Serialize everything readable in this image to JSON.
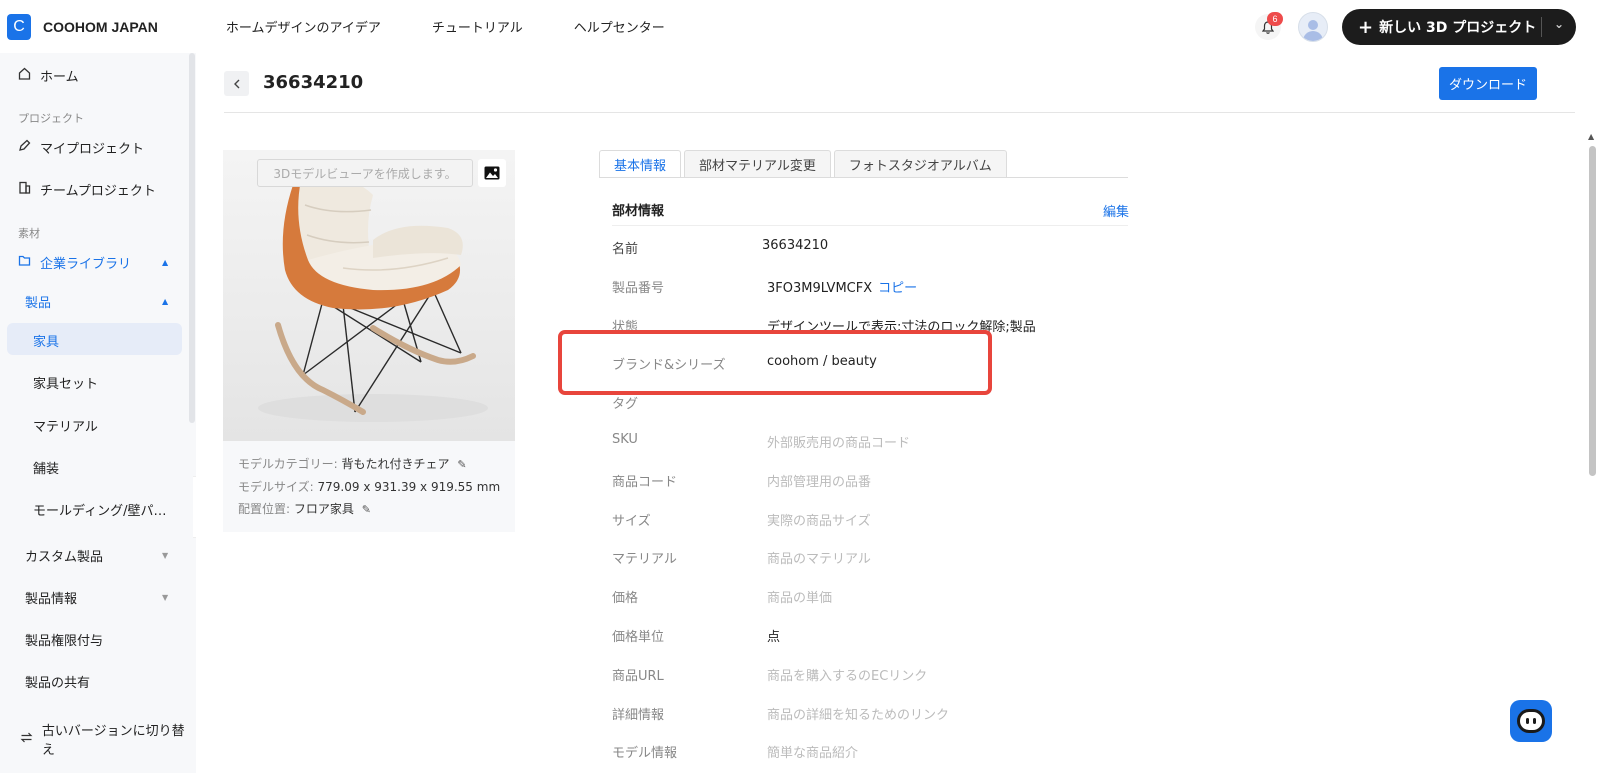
{
  "brand": {
    "logo_letter": "C",
    "name": "COOHOM JAPAN"
  },
  "topnav": {
    "items": [
      "ホームデザインのアイデア",
      "チュートリアル",
      "ヘルプセンター"
    ]
  },
  "top_right": {
    "notification_count": "6",
    "new_project_plus": "+",
    "new_project_label": "新しい 3D プロジェクト"
  },
  "sidebar": {
    "home": "ホーム",
    "section_project": "プロジェクト",
    "my_projects": "マイプロジェクト",
    "team_projects": "チームプロジェクト",
    "section_material": "素材",
    "enterprise_library": "企業ライブラリ",
    "products": "製品",
    "furniture": "家具",
    "furniture_set": "家具セット",
    "material": "マテリアル",
    "paving": "舗装",
    "molding": "モールディング/壁パ…",
    "custom_products": "カスタム製品",
    "product_info": "製品情報",
    "product_permission": "製品権限付与",
    "product_sharing": "製品の共有",
    "switch_old_version": "古いバージョンに切り替え"
  },
  "header": {
    "title": "36634210",
    "download_label": "ダウンロード"
  },
  "card": {
    "viewer_placeholder": "3Dモデルビューアを作成します。",
    "category_label": "モデルカテゴリー:",
    "category_value": "背もたれ付きチェア",
    "size_label": "モデルサイズ:",
    "size_value": "779.09 x 931.39 x 919.55 mm",
    "placement_label": "配置位置:",
    "placement_value": "フロア家具"
  },
  "tabs": [
    "基本情報",
    "部材マテリアル変更",
    "フォトスタジオアルバム"
  ],
  "info": {
    "section_title": "部材情報",
    "edit_label": "編集",
    "copy_label": "コピー",
    "rows": [
      {
        "label": "名前",
        "value": "36634210"
      },
      {
        "label": "製品番号",
        "value": "3FO3M9LVMCFX"
      },
      {
        "label": "状態",
        "value": "デザインツールで表示;寸法のロック解除;製品"
      },
      {
        "label": "ブランド&シリーズ",
        "value": "coohom / beauty"
      },
      {
        "label": "タグ",
        "value": ""
      },
      {
        "label": "SKU",
        "value": "外部販売用の商品コード"
      },
      {
        "label": "商品コード",
        "value": "内部管理用の品番"
      },
      {
        "label": "サイズ",
        "value": "実際の商品サイズ"
      },
      {
        "label": "マテリアル",
        "value": "商品のマテリアル"
      },
      {
        "label": "価格",
        "value": "商品の単価"
      },
      {
        "label": "価格単位",
        "value": "点"
      },
      {
        "label": "商品URL",
        "value": "商品を購入するのECリンク"
      },
      {
        "label": "詳細情報",
        "value": "商品の詳細を知るためのリンク"
      },
      {
        "label": "モデル情報",
        "value": "簡単な商品紹介"
      }
    ]
  },
  "colors": {
    "accent": "#1a73e8",
    "highlight": "#e8453c",
    "new_project_bg": "#1c1c1c"
  },
  "icons": [
    "bell-icon",
    "avatar-icon",
    "home-icon",
    "pen-icon",
    "building-icon",
    "folder-icon",
    "picture-icon",
    "pencil-icon",
    "chat-icon",
    "switch-icon"
  ]
}
